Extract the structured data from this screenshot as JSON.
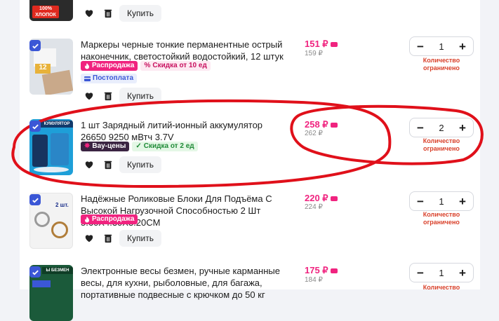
{
  "items": [
    {
      "title": "",
      "badges": [],
      "thumb_text": "100% ХЛОПОК",
      "buy_label": "Купить"
    },
    {
      "title": "Маркеры черные тонкие перманентные острый наконечник, светостойкий водостойкий, 12 штук",
      "badge_sale": "Распродажа",
      "badge_discount": "Скидка от 10 ед",
      "badge_post": "Постоплата",
      "thumb_text": "12",
      "price": "151 ₽",
      "old_price": "159 ₽",
      "quantity": "1",
      "limit_text": "Количество ограничено",
      "buy_label": "Купить"
    },
    {
      "title": "1 шт Зарядный литий-ионный аккумулятор 26650 9250 мВтч 3.7V",
      "badge_wow": "Вау-цены",
      "badge_discount": "Скидка от 2 ед",
      "thumb_text": "КУМУЛЯТОР",
      "price": "258 ₽",
      "old_price": "262 ₽",
      "quantity": "2",
      "limit_text": "Количество ограничено",
      "buy_label": "Купить"
    },
    {
      "title": "Надёжные Роликовые Блоки Для Подъёма С Высокой Нагрузочной Способностью 2 Шт 5.60X4.30X3.20CM",
      "badge_sale": "Распродажа",
      "thumb_text": "2 шт.",
      "price": "220 ₽",
      "old_price": "224 ₽",
      "quantity": "1",
      "limit_text": "Количество ограничено",
      "buy_label": "Купить"
    },
    {
      "title": "Электронные весы безмен, ручные карманные весы, для кухни, рыболовные, для багажа, портативные подвесные с крючком до 50 кг",
      "thumb_text": "Ы БЕЗМЕН",
      "price": "175 ₽",
      "old_price": "184 ₽",
      "quantity": "1",
      "limit_text": "Количество"
    }
  ],
  "colors": {
    "accent": "#3b57d6",
    "price": "#f0237f",
    "limit": "#d9412b",
    "annotation": "#e0101a"
  }
}
